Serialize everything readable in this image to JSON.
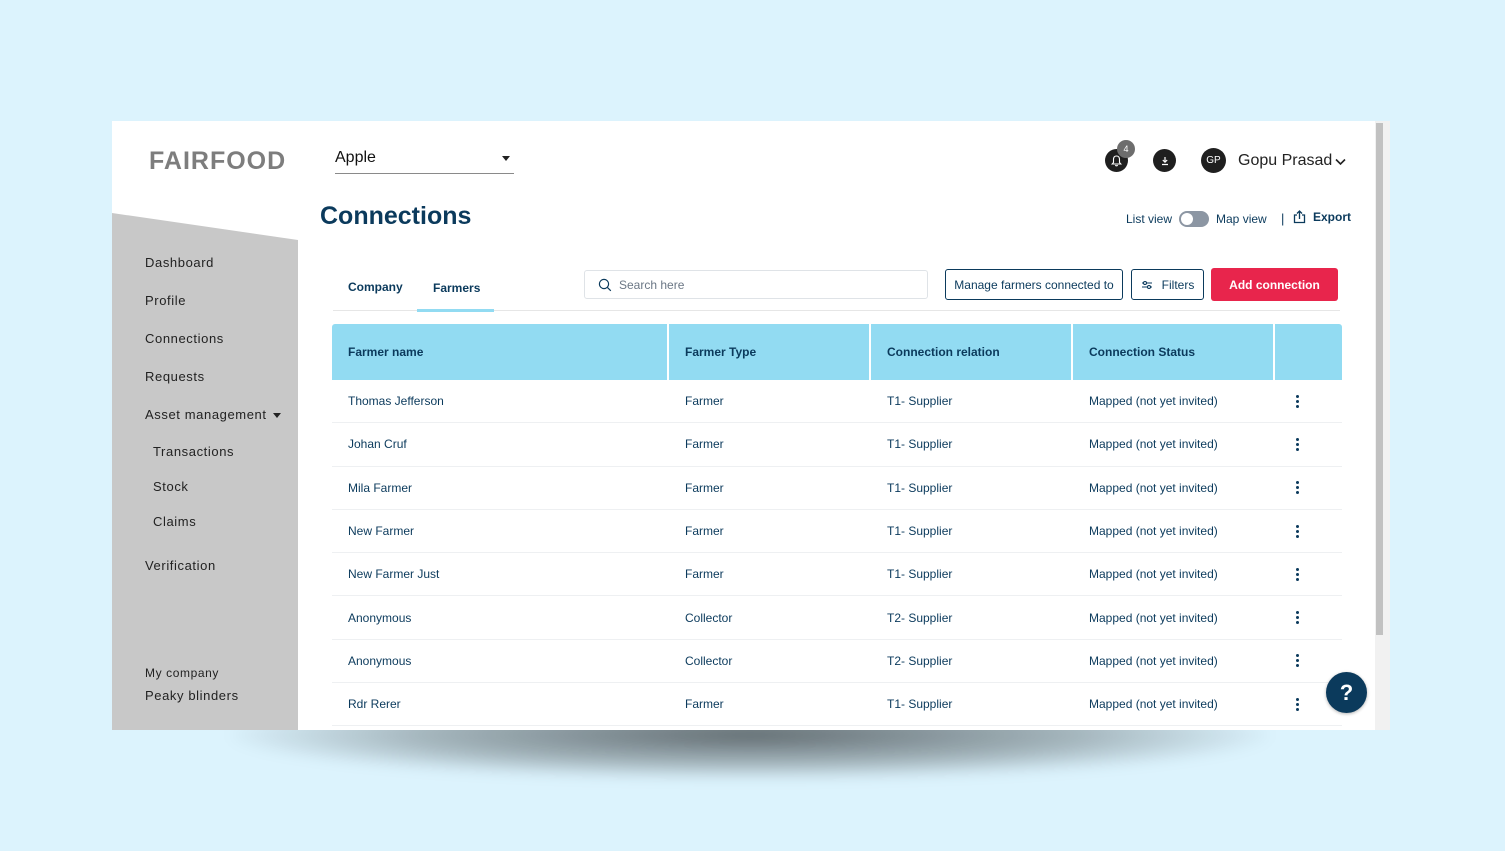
{
  "header": {
    "logo": "FAIRFOOD",
    "company_select": "Apple",
    "notification_count": "4",
    "avatar_initials": "GP",
    "user_name": "Gopu Prasad"
  },
  "sidebar": {
    "items": [
      {
        "label": "Dashboard"
      },
      {
        "label": "Profile"
      },
      {
        "label": "Connections"
      },
      {
        "label": "Requests"
      },
      {
        "label": "Asset management"
      },
      {
        "label": "Transactions"
      },
      {
        "label": "Stock"
      },
      {
        "label": "Claims"
      },
      {
        "label": "Verification"
      }
    ],
    "footer_label": "My company",
    "footer_company": "Peaky blinders"
  },
  "main": {
    "title": "Connections",
    "list_view_label": "List view",
    "map_view_label": "Map view",
    "separator": "|",
    "export_label": "Export",
    "tabs": [
      {
        "label": "Company",
        "active": false
      },
      {
        "label": "Farmers",
        "active": true
      }
    ],
    "search_placeholder": "Search here",
    "manage_button": "Manage farmers connected to",
    "filters_button": "Filters",
    "add_button": "Add connection"
  },
  "table": {
    "columns": [
      "Farmer name",
      "Farmer Type",
      "Connection relation",
      "Connection Status",
      ""
    ],
    "rows": [
      {
        "name": "Thomas Jefferson",
        "type": "Farmer",
        "relation": "T1- Supplier",
        "status": "Mapped (not yet invited)"
      },
      {
        "name": "Johan Cruf",
        "type": "Farmer",
        "relation": "T1- Supplier",
        "status": "Mapped (not yet invited)"
      },
      {
        "name": "Mila Farmer",
        "type": "Farmer",
        "relation": "T1- Supplier",
        "status": "Mapped (not yet invited)"
      },
      {
        "name": "New Farmer",
        "type": "Farmer",
        "relation": "T1- Supplier",
        "status": "Mapped (not yet invited)"
      },
      {
        "name": "New Farmer Just",
        "type": "Farmer",
        "relation": "T1- Supplier",
        "status": "Mapped (not yet invited)"
      },
      {
        "name": "Anonymous",
        "type": "Collector",
        "relation": "T2- Supplier",
        "status": "Mapped (not yet invited)"
      },
      {
        "name": "Anonymous",
        "type": "Collector",
        "relation": "T2- Supplier",
        "status": "Mapped (not yet invited)"
      },
      {
        "name": "Rdr Rerer",
        "type": "Farmer",
        "relation": "T1- Supplier",
        "status": "Mapped (not yet invited)"
      }
    ]
  },
  "help_button": "?",
  "colors": {
    "background": "#dcf3fd",
    "primary_text": "#0b3a5c",
    "table_header": "#92dbf2",
    "accent_red": "#e8254c",
    "sidebar": "#c8c8c8"
  }
}
